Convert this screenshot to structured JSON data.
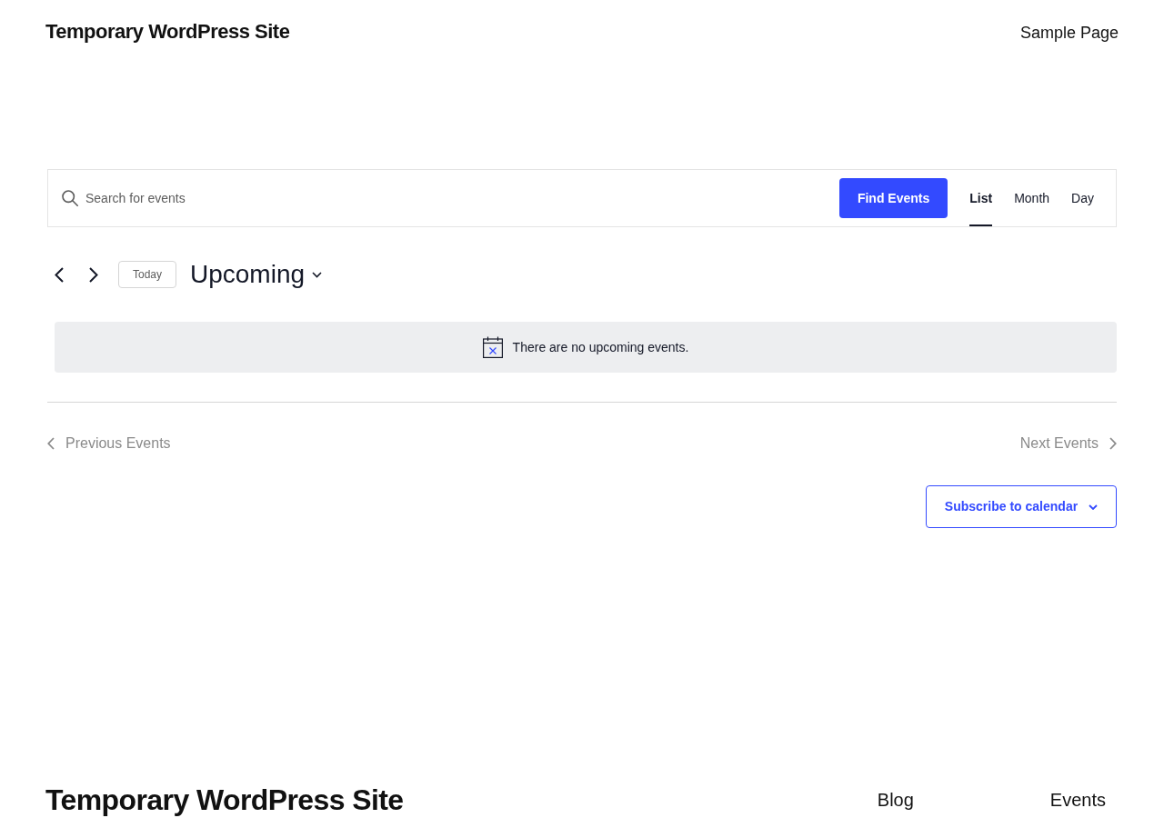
{
  "header": {
    "site_title": "Temporary WordPress Site",
    "nav": [
      "Sample Page"
    ]
  },
  "event_bar": {
    "search": {
      "placeholder": "Search for events"
    },
    "submit": "Find Events",
    "views": [
      {
        "label": "List",
        "selected": true
      },
      {
        "label": "Month",
        "selected": false
      },
      {
        "label": "Day",
        "selected": false
      }
    ]
  },
  "date_nav": {
    "today": "Today",
    "title": "Upcoming"
  },
  "notice": "There are no upcoming events.",
  "pagination": {
    "previous": {
      "label": "Previous Events",
      "disabled": true
    },
    "next": {
      "label": "Next Events",
      "disabled": true
    }
  },
  "subscribe": "Subscribe to calendar",
  "footer": {
    "site_title": "Temporary WordPress Site",
    "nav": [
      "Blog",
      "Events"
    ]
  }
}
